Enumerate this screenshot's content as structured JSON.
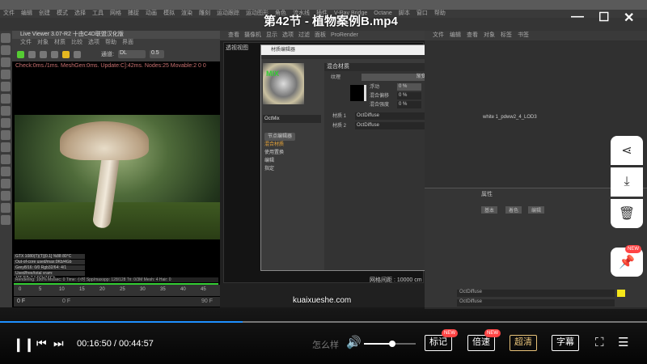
{
  "video": {
    "title": "第42节 - 植物案例B.mp4",
    "current_time": "00:16:50",
    "total_time": "00:44:57",
    "progress_percent": 37.5,
    "volume_percent": 55,
    "watermark": "kuaixueshe.com",
    "subtitle_text": "怎么样"
  },
  "controls": {
    "mark": "标记",
    "speed": "倍速",
    "quality": "超清",
    "subtitle": "字幕",
    "new_badge": "NEW"
  },
  "side_actions": [
    "share-icon",
    "download-icon",
    "delete-icon",
    "pin-icon"
  ],
  "c4d": {
    "menu": [
      "文件",
      "编辑",
      "创建",
      "模式",
      "选择",
      "工具",
      "网格",
      "捕捉",
      "动画",
      "模拟",
      "渲染",
      "雕刻",
      "运动跟踪",
      "运动图形",
      "角色",
      "流水线",
      "插件",
      "V-Ray Bridge",
      "Octane",
      "脚本",
      "窗口",
      "帮助"
    ],
    "layout": "octane xb (用户)",
    "live_viewer": {
      "title": "Live Viewer 3.07-R2 十由C4D联盟汉化版",
      "menu": [
        "文件",
        "对象",
        "材质",
        "比较",
        "选项",
        "帮助",
        "界面"
      ],
      "channel": "DL",
      "value": "0.5",
      "status": "Check:0ms./1ms. MeshGen:0ms. Update:C]:42ms. Nodes:25 Movable:2  0 0",
      "stats": [
        "GTX 1080(T)(T)[0.1]   %88   80°C",
        "Out-of-core used/max:0Kb/4Gb",
        "Grey8/16: 0/0    Rgb32/64: 4/1",
        "Used/free/total vram: 1054Mb/14.6Gb/16Gb"
      ],
      "render_line": "Rendering: 100%  Ms/sec: 0  Time: 小时  Spp/maxspp: 128/128  Tri: 0/3M  Mesh: 4  Hair: 0"
    },
    "timeline": {
      "ticks": [
        "0",
        "5",
        "10",
        "15",
        "20",
        "25",
        "30",
        "35",
        "40",
        "45",
        "5"
      ],
      "start": "0 F",
      "end": "90 F",
      "range_start": "0 F"
    },
    "viewport": {
      "menu": [
        "查看",
        "摄像机",
        "显示",
        "选项",
        "过滤",
        "面板",
        "ProRender"
      ],
      "label": "透视视图",
      "grid_distance": "网格间距 : 10000 cm"
    },
    "object_manager": {
      "menu": [
        "文件",
        "编辑",
        "查看",
        "对象",
        "标签",
        "书签"
      ],
      "row": "white 1_pdww2_4_LOD3"
    },
    "material_dialog": {
      "title": "材质编辑器",
      "preview_label": "MIX",
      "name": "OctMix",
      "node_editor": "节点编辑器",
      "list": [
        "混合材质",
        "使用置换",
        "编辑",
        "指定"
      ],
      "section": "混合材质",
      "texture_label": "纹理",
      "texture_value": "渐变",
      "float_label": "浮动",
      "float_value": "0 %",
      "blend_label": "混合偏移",
      "blend_value": "0 %",
      "fade_label": "混合强度",
      "fade_value": "0 %",
      "material1_label": "材质 1",
      "material1": "OctDiffuse",
      "material2_label": "材质 2",
      "material2": "OctDiffuse",
      "accent": "#f5e61a"
    },
    "attributes": {
      "title": "属性",
      "tabs": [
        "基本",
        "着色",
        "编辑"
      ],
      "mat1": "OctDiffuse",
      "mat2": "OctDiffuse"
    }
  }
}
